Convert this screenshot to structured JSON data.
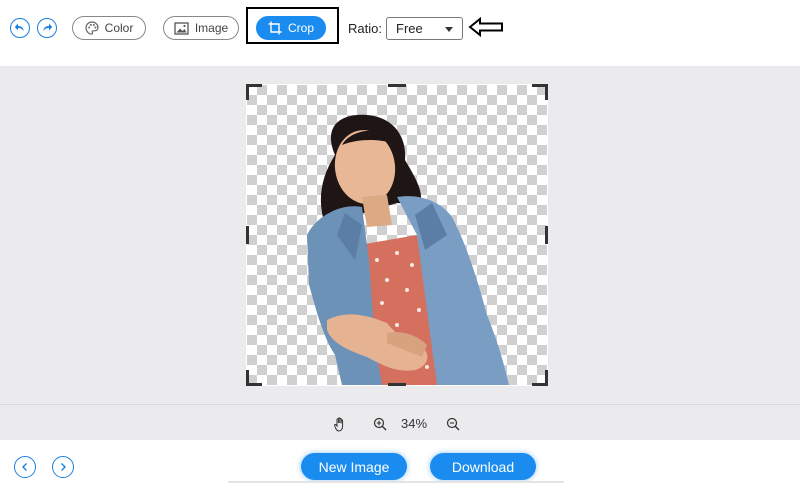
{
  "toolbar": {
    "undo_icon": "undo-icon",
    "redo_icon": "redo-icon",
    "color_label": "Color",
    "image_label": "Image",
    "crop_label": "Crop",
    "ratio_label": "Ratio:",
    "ratio_value": "Free",
    "accent_color": "#1a8cf0"
  },
  "zoom": {
    "value": "34%",
    "icons": [
      "hand-icon",
      "zoom-in-icon",
      "zoom-out-icon"
    ]
  },
  "footer": {
    "new_image_label": "New Image",
    "download_label": "Download"
  }
}
